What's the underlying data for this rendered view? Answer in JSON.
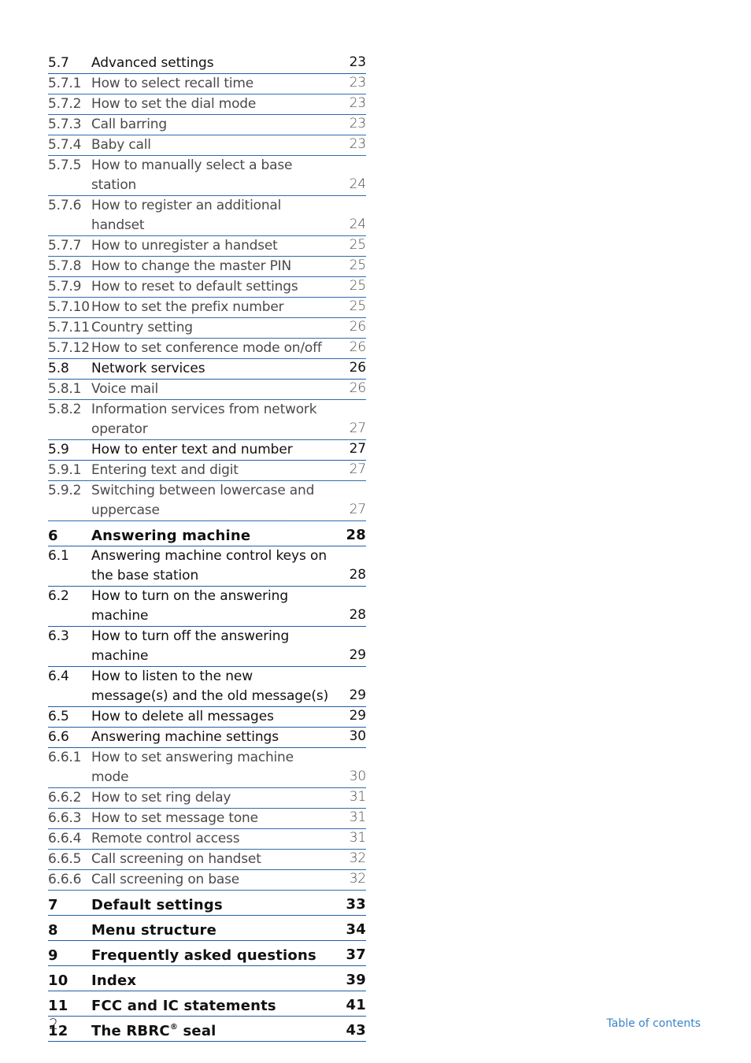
{
  "toc": [
    {
      "num": "5.7",
      "title": "Advanced settings",
      "page": "23",
      "level": "sec"
    },
    {
      "num": "5.7.1",
      "title": "How to select recall time",
      "page": "23",
      "level": "sub"
    },
    {
      "num": "5.7.2",
      "title": "How to set the dial mode",
      "page": "23",
      "level": "sub"
    },
    {
      "num": "5.7.3",
      "title": "Call barring",
      "page": "23",
      "level": "sub"
    },
    {
      "num": "5.7.4",
      "title": "Baby call",
      "page": "23",
      "level": "sub"
    },
    {
      "num": "5.7.5",
      "title": "How to manually select a base station",
      "page": "24",
      "level": "sub"
    },
    {
      "num": "5.7.6",
      "title": "How to register an additional handset",
      "page": "24",
      "level": "sub"
    },
    {
      "num": "5.7.7",
      "title": "How to unregister a handset",
      "page": "25",
      "level": "sub"
    },
    {
      "num": "5.7.8",
      "title": "How to change the master PIN",
      "page": "25",
      "level": "sub"
    },
    {
      "num": "5.7.9",
      "title": "How to reset to default settings",
      "page": "25",
      "level": "sub"
    },
    {
      "num": "5.7.10",
      "title": "How to set the prefix number",
      "page": "25",
      "level": "sub"
    },
    {
      "num": "5.7.11",
      "title": "Country setting",
      "page": "26",
      "level": "sub"
    },
    {
      "num": "5.7.12",
      "title": "How to set conference mode on/off",
      "page": "26",
      "level": "sub"
    },
    {
      "num": "5.8",
      "title": "Network services",
      "page": "26",
      "level": "sec"
    },
    {
      "num": "5.8.1",
      "title": "Voice mail",
      "page": "26",
      "level": "sub"
    },
    {
      "num": "5.8.2",
      "title": "Information services from network operator",
      "page": "27",
      "level": "sub",
      "multi": true
    },
    {
      "num": "5.9",
      "title": "How to enter text and number",
      "page": "27",
      "level": "sec"
    },
    {
      "num": "5.9.1",
      "title": "Entering text and digit",
      "page": "27",
      "level": "sub"
    },
    {
      "num": "5.9.2",
      "title": "Switching between lowercase and uppercase",
      "page": "27",
      "level": "sub",
      "multi": true
    },
    {
      "num": "6",
      "title": "Answering machine",
      "page": "28",
      "level": "ch"
    },
    {
      "num": "6.1",
      "title": "Answering machine control keys on the base station",
      "page": "28",
      "level": "sec",
      "multi": true
    },
    {
      "num": "6.2",
      "title": "How to turn on the answering machine",
      "page": "28",
      "level": "sec",
      "multi": true
    },
    {
      "num": "6.3",
      "title": "How to turn off the answering machine",
      "page": "29",
      "level": "sec",
      "multi": true,
      "noline": true
    },
    {
      "num": "6.4",
      "title": "How to listen to the new message(s) and the old message(s)",
      "page": "29",
      "level": "sec",
      "multi": true
    },
    {
      "num": "6.5",
      "title": "How to delete all messages",
      "page": "29",
      "level": "sec"
    },
    {
      "num": "6.6",
      "title": "Answering machine settings",
      "page": "30",
      "level": "sec"
    },
    {
      "num": "6.6.1",
      "title": "How to set answering machine mode",
      "page": "30",
      "level": "sub"
    },
    {
      "num": "6.6.2",
      "title": "How to set ring delay",
      "page": "31",
      "level": "sub"
    },
    {
      "num": "6.6.3",
      "title": "How to set message tone",
      "page": "31",
      "level": "sub"
    },
    {
      "num": "6.6.4",
      "title": "Remote control access",
      "page": "31",
      "level": "sub"
    },
    {
      "num": "6.6.5",
      "title": "Call screening on handset",
      "page": "32",
      "level": "sub"
    },
    {
      "num": "6.6.6",
      "title": "Call screening on base",
      "page": "32",
      "level": "sub"
    },
    {
      "num": "7",
      "title": "Default settings",
      "page": "33",
      "level": "ch"
    },
    {
      "num": "8",
      "title": "Menu structure",
      "page": "34",
      "level": "ch"
    },
    {
      "num": "9",
      "title": "Frequently asked questions",
      "page": "37",
      "level": "ch"
    },
    {
      "num": "10",
      "title": "Index",
      "page": "39",
      "level": "ch"
    },
    {
      "num": "11",
      "title": "FCC and IC statements",
      "page": "41",
      "level": "ch"
    },
    {
      "num": "12",
      "title": "The RBRC",
      "title_sup": "®",
      "title_after": " seal",
      "page": "43",
      "level": "ch"
    }
  ],
  "footer": {
    "page_number": "2",
    "section_title": "Table of contents"
  },
  "colors": {
    "rule": "#1f5fa8",
    "footer_accent": "#3b82c8"
  }
}
